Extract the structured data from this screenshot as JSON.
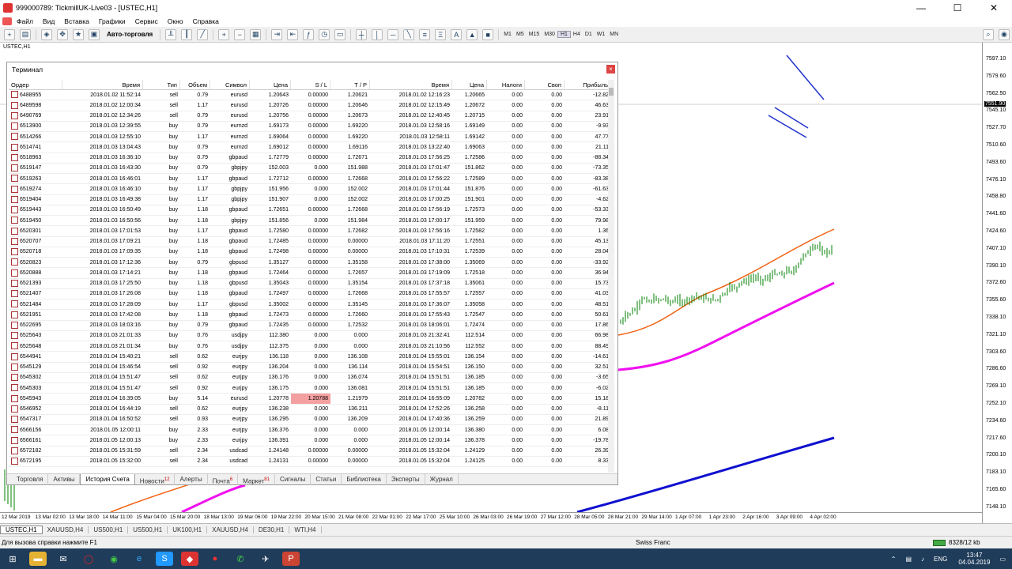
{
  "title": "999000789: TickmillUK-Live03 - [USTEC,H1]",
  "menu": [
    "Файл",
    "Вид",
    "Вставка",
    "Графики",
    "Сервис",
    "Окно",
    "Справка"
  ],
  "toolbar": {
    "autotrade": "Авто-торговля",
    "timeframes": [
      "M1",
      "M5",
      "M15",
      "M30",
      "H1",
      "H4",
      "D1",
      "W1",
      "MN"
    ],
    "active_tf": "H1"
  },
  "chart": {
    "symbol": "USTEC,H1",
    "current_price": "7551.90",
    "price_labels": [
      "7597.10",
      "7579.60",
      "7562.50",
      "7545.10",
      "7527.70",
      "7510.60",
      "7493.60",
      "7476.10",
      "7458.80",
      "7441.60",
      "7424.60",
      "7407.10",
      "7390.10",
      "7372.60",
      "7355.60",
      "7338.10",
      "7321.10",
      "7303.60",
      "7286.60",
      "7269.10",
      "7252.10",
      "7234.60",
      "7217.60",
      "7200.10",
      "7183.10",
      "7165.60",
      "7148.10"
    ],
    "time_labels": [
      "12 Mar 2019",
      "13 Mar 02:00",
      "13 Mar 18:00",
      "14 Mar 11:00",
      "15 Mar 04:00",
      "15 Mar 20:00",
      "18 Mar 13:00",
      "19 Mar 06:00",
      "19 Mar 22:00",
      "20 Mar 15:00",
      "21 Mar 08:00",
      "22 Mar 01:00",
      "22 Mar 17:00",
      "25 Mar 10:00",
      "26 Mar 03:00",
      "26 Mar 19:00",
      "27 Mar 12:00",
      "28 Mar 05:00",
      "28 Mar 21:00",
      "29 Mar 14:00",
      "1 Apr 07:00",
      "1 Apr 23:00",
      "2 Apr 16:00",
      "3 Apr 09:00",
      "4 Apr 02:00"
    ],
    "colors": {
      "ma1": "#f06010",
      "ma2": "#f010f0",
      "ma3": "#1010d0",
      "candles": "#008000"
    }
  },
  "terminal": {
    "title": "Терминал",
    "headers": [
      "Ордер",
      "Время",
      "Тип",
      "Объем",
      "Символ",
      "Цена",
      "S / L",
      "T / P",
      "Время",
      "Цена",
      "Налоги",
      "Своп",
      "Прибыль"
    ],
    "rows": [
      [
        "6488955",
        "2018.01.02 11:52:14",
        "sell",
        "0.79",
        "eurusd",
        "1.20643",
        "0.00000",
        "1.20621",
        "2018.01.02 12:16:23",
        "1.20665",
        "0.00",
        "0.00",
        "-12.82"
      ],
      [
        "6489598",
        "2018.01.02 12:00:34",
        "sell",
        "1.17",
        "eurusd",
        "1.20726",
        "0.00000",
        "1.20646",
        "2018.01.02 12:15:49",
        "1.20672",
        "0.00",
        "0.00",
        "46.63"
      ],
      [
        "6490769",
        "2018.01.02 12:34:26",
        "sell",
        "0.79",
        "eurusd",
        "1.20756",
        "0.00000",
        "1.20673",
        "2018.01.02 12:40:45",
        "1.20715",
        "0.00",
        "0.00",
        "23.91"
      ],
      [
        "6513900",
        "2018.01.03 12:39:55",
        "buy",
        "0.79",
        "eurnzd",
        "1.69173",
        "0.00000",
        "1.69220",
        "2018.01.03 12:58:16",
        "1.69149",
        "0.00",
        "0.00",
        "-9.93"
      ],
      [
        "6514266",
        "2018.01.03 12:55:10",
        "buy",
        "1.17",
        "eurnzd",
        "1.69064",
        "0.00000",
        "1.69220",
        "2018.01.03 12:58:11",
        "1.69142",
        "0.00",
        "0.00",
        "47.77"
      ],
      [
        "6514741",
        "2018.01.03 13:04:43",
        "buy",
        "0.79",
        "eurnzd",
        "1.69012",
        "0.00000",
        "1.69116",
        "2018.01.03 13:22:40",
        "1.69063",
        "0.00",
        "0.00",
        "21.11"
      ],
      [
        "6518963",
        "2018.01.03 16:36:10",
        "buy",
        "0.79",
        "gbpaud",
        "1.72779",
        "0.00000",
        "1.72671",
        "2018.01.03 17:56:25",
        "1.72586",
        "0.00",
        "0.00",
        "-88.34"
      ],
      [
        "6519147",
        "2018.01.03 16:43:30",
        "buy",
        "0.79",
        "gbpjpy",
        "152.003",
        "0.000",
        "151.988",
        "2018.01.03 17:01:47",
        "151.862",
        "0.00",
        "0.00",
        "-73.35"
      ],
      [
        "6519263",
        "2018.01.03 16:46:01",
        "buy",
        "1.17",
        "gbpaud",
        "1.72712",
        "0.00000",
        "1.72668",
        "2018.01.03 17:56:22",
        "1.72589",
        "0.00",
        "0.00",
        "-83.38"
      ],
      [
        "6519274",
        "2018.01.03 16:46:10",
        "buy",
        "1.17",
        "gbpjpy",
        "151.956",
        "0.000",
        "152.002",
        "2018.01.03 17:01:44",
        "151.876",
        "0.00",
        "0.00",
        "-61.63"
      ],
      [
        "6519404",
        "2018.01.03 16:49:38",
        "buy",
        "1.17",
        "gbpjpy",
        "151.907",
        "0.000",
        "152.002",
        "2018.01.03 17:00:25",
        "151.901",
        "0.00",
        "0.00",
        "-4.62"
      ],
      [
        "6519443",
        "2018.01.03 16:50:49",
        "buy",
        "1.18",
        "gbpaud",
        "1.72651",
        "0.00000",
        "1.72668",
        "2018.01.03 17:56:19",
        "1.72573",
        "0.00",
        "0.00",
        "-53.33"
      ],
      [
        "6519450",
        "2018.01.03 16:50:56",
        "buy",
        "1.18",
        "gbpjpy",
        "151.856",
        "0.000",
        "151.984",
        "2018.01.03 17:00:17",
        "151.959",
        "0.00",
        "0.00",
        "79.98"
      ],
      [
        "6520301",
        "2018.01.03 17:01:53",
        "buy",
        "1.17",
        "gbpaud",
        "1.72580",
        "0.00000",
        "1.72682",
        "2018.01.03 17:56:16",
        "1.72582",
        "0.00",
        "0.00",
        "1.36"
      ],
      [
        "6520707",
        "2018.01.03 17:09:21",
        "buy",
        "1.18",
        "gbpaud",
        "1.72485",
        "0.00000",
        "0.00000",
        "2018.01.03 17:11:20",
        "1.72551",
        "0.00",
        "0.00",
        "45.13"
      ],
      [
        "6520718",
        "2018.01.03 17:09:35",
        "buy",
        "1.18",
        "gbpaud",
        "1.72498",
        "0.00000",
        "0.00000",
        "2018.01.03 17:10:31",
        "1.72539",
        "0.00",
        "0.00",
        "28.04"
      ],
      [
        "6520823",
        "2018.01.03 17:12:36",
        "buy",
        "0.79",
        "gbpusd",
        "1.35127",
        "0.00000",
        "1.35158",
        "2018.01.03 17:38:00",
        "1.35069",
        "0.00",
        "0.00",
        "-33.92"
      ],
      [
        "6520888",
        "2018.01.03 17:14:21",
        "buy",
        "1.18",
        "gbpaud",
        "1.72464",
        "0.00000",
        "1.72657",
        "2018.01.03 17:19:09",
        "1.72518",
        "0.00",
        "0.00",
        "36.94"
      ],
      [
        "6521393",
        "2018.01.03 17:25:50",
        "buy",
        "1.18",
        "gbpusd",
        "1.35043",
        "0.00000",
        "1.35154",
        "2018.01.03 17:37:18",
        "1.35061",
        "0.00",
        "0.00",
        "15.73"
      ],
      [
        "6521407",
        "2018.01.03 17:26:08",
        "buy",
        "1.18",
        "gbpaud",
        "1.72497",
        "0.00000",
        "1.72668",
        "2018.01.03 17:55:57",
        "1.72557",
        "0.00",
        "0.00",
        "41.03"
      ],
      [
        "6521484",
        "2018.01.03 17:28:09",
        "buy",
        "1.17",
        "gbpusd",
        "1.35002",
        "0.00000",
        "1.35145",
        "2018.01.03 17:36:07",
        "1.35058",
        "0.00",
        "0.00",
        "48.51"
      ],
      [
        "6521951",
        "2018.01.03 17:42:08",
        "buy",
        "1.18",
        "gbpaud",
        "1.72473",
        "0.00000",
        "1.72660",
        "2018.01.03 17:55:43",
        "1.72547",
        "0.00",
        "0.00",
        "50.61"
      ],
      [
        "6522695",
        "2018.01.03 18:03:16",
        "buy",
        "0.79",
        "gbpaud",
        "1.72435",
        "0.00000",
        "1.72532",
        "2018.01.03 18:06:01",
        "1.72474",
        "0.00",
        "0.00",
        "17.86"
      ],
      [
        "6525643",
        "2018.01.03 21:01:33",
        "buy",
        "0.76",
        "usdjpy",
        "112.380",
        "0.000",
        "0.000",
        "2018.01.03 21:32:41",
        "112.514",
        "0.00",
        "0.00",
        "66.98"
      ],
      [
        "6525648",
        "2018.01.03 21:01:34",
        "buy",
        "0.76",
        "usdjpy",
        "112.375",
        "0.000",
        "0.000",
        "2018.01.03 21:10:56",
        "112.552",
        "0.00",
        "0.00",
        "88.49"
      ],
      [
        "6544941",
        "2018.01.04 15:40:21",
        "sell",
        "0.62",
        "eurjpy",
        "136.118",
        "0.000",
        "136.108",
        "2018.01.04 15:55:01",
        "136.154",
        "0.00",
        "0.00",
        "-14.61"
      ],
      [
        "6545129",
        "2018.01.04 15:46:54",
        "sell",
        "0.92",
        "eurjpy",
        "136.204",
        "0.000",
        "136.114",
        "2018.01.04 15:54:51",
        "136.150",
        "0.00",
        "0.00",
        "32.51"
      ],
      [
        "6545302",
        "2018.01.04 15:51:47",
        "sell",
        "0.62",
        "eurjpy",
        "136.176",
        "0.000",
        "136.074",
        "2018.01.04 15:51:51",
        "136.185",
        "0.00",
        "0.00",
        "-3.65"
      ],
      [
        "6545303",
        "2018.01.04 15:51:47",
        "sell",
        "0.92",
        "eurjpy",
        "136.175",
        "0.000",
        "136.081",
        "2018.01.04 15:51:51",
        "136.185",
        "0.00",
        "0.00",
        "-6.02"
      ],
      [
        "6545943",
        "2018.01.04 16:39:05",
        "buy",
        "5.14",
        "eurusd",
        "1.20778",
        "1.20788",
        "1.21979",
        "2018.01.04 16:55:09",
        "1.20782",
        "0.00",
        "0.00",
        "15.18"
      ],
      [
        "6546952",
        "2018.01.04 16:44:19",
        "sell",
        "0.62",
        "eurjpy",
        "136.238",
        "0.000",
        "136.211",
        "2018.01.04 17:52:26",
        "136.258",
        "0.00",
        "0.00",
        "-8.11"
      ],
      [
        "6547317",
        "2018.01.04 16:50:52",
        "sell",
        "0.93",
        "eurjpy",
        "136.295",
        "0.000",
        "136.209",
        "2018.01.04 17:40:36",
        "136.259",
        "0.00",
        "0.00",
        "21.89"
      ],
      [
        "6566156",
        "2018.01.05 12:00:11",
        "buy",
        "2.33",
        "eurjpy",
        "136.376",
        "0.000",
        "0.000",
        "2018.01.05 12:00:14",
        "136.380",
        "0.00",
        "0.00",
        "6.08"
      ],
      [
        "6566161",
        "2018.01.05 12:00:13",
        "buy",
        "2.33",
        "eurjpy",
        "136.391",
        "0.000",
        "0.000",
        "2018.01.05 12:00:14",
        "136.378",
        "0.00",
        "0.00",
        "-19.78"
      ],
      [
        "6572182",
        "2018.01.05 15:31:59",
        "sell",
        "2.34",
        "usdcad",
        "1.24148",
        "0.00000",
        "0.00000",
        "2018.01.05 15:32:04",
        "1.24129",
        "0.00",
        "0.00",
        "26.39"
      ],
      [
        "6572195",
        "2018.01.05 15:32:00",
        "sell",
        "2.34",
        "usdcad",
        "1.24131",
        "0.00000",
        "0.00000",
        "2018.01.05 15:32:04",
        "1.24125",
        "0.00",
        "0.00",
        "8.33"
      ]
    ],
    "tabs": [
      {
        "label": "Торговля",
        "badge": ""
      },
      {
        "label": "Активы",
        "badge": ""
      },
      {
        "label": "История Счета",
        "badge": ""
      },
      {
        "label": "Новости",
        "badge": "12"
      },
      {
        "label": "Алерты",
        "badge": ""
      },
      {
        "label": "Почта",
        "badge": "6"
      },
      {
        "label": "Маркет",
        "badge": "81"
      },
      {
        "label": "Сигналы",
        "badge": ""
      },
      {
        "label": "Статьи",
        "badge": ""
      },
      {
        "label": "Библиотека",
        "badge": ""
      },
      {
        "label": "Эксперты",
        "badge": ""
      },
      {
        "label": "Журнал",
        "badge": ""
      }
    ],
    "active_tab": "История Счета"
  },
  "symbol_tabs": [
    "USTEC,H1",
    "XAUUSD,H4",
    "US500,H1",
    "US500,H1",
    "UK100,H1",
    "XAUUSD,H4",
    "DE30,H1",
    "WTI,H4"
  ],
  "status": {
    "help": "Для вызова справки нажмите F1",
    "profile": "Swiss Franc",
    "traffic": "8328/12 kb"
  },
  "taskbar": {
    "lang": "ENG",
    "time": "13:47",
    "date": "04.04.2019"
  }
}
